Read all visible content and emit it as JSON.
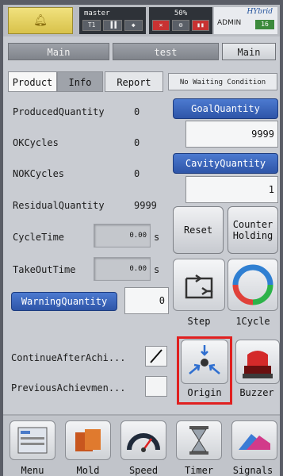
{
  "status": {
    "alarm_icon": "bell-icon",
    "branch": "master",
    "mode_cells": [
      "T1",
      "▐▐",
      "◆"
    ],
    "speed": "50%",
    "speed_cells": [
      "✕",
      "⚙",
      "▮▮"
    ],
    "brand": "HYbrid",
    "user": "ADMIN",
    "level": "16"
  },
  "tabs": [
    "Main",
    "test",
    "Main"
  ],
  "subtabs": [
    "Product",
    "Info",
    "Report"
  ],
  "wait_label": "No Waiting Condition",
  "rows": {
    "produced": {
      "label": "ProducedQuantity",
      "value": "0"
    },
    "ok": {
      "label": "OKCycles",
      "value": "0"
    },
    "nok": {
      "label": "NOKCycles",
      "value": "0"
    },
    "residual": {
      "label": "ResidualQuantity",
      "value": "9999"
    },
    "cycle": {
      "label": "CycleTime",
      "value": "0.00",
      "unit": "s"
    },
    "takeout": {
      "label": "TakeOutTime",
      "value": "0.00",
      "unit": "s"
    }
  },
  "warning": {
    "label": "WarningQuantity",
    "value": "0"
  },
  "goal": {
    "label": "GoalQuantity",
    "value": "9999"
  },
  "cavity": {
    "label": "CavityQuantity",
    "value": "1"
  },
  "buttons": {
    "reset": "Reset",
    "counter_line1": "Counter",
    "counter_line2": "Holding",
    "step": "Step",
    "cycle": "1Cycle",
    "origin": "Origin",
    "buzzer": "Buzzer"
  },
  "checks": {
    "continue": {
      "label": "ContinueAfterAchi...",
      "checked": true
    },
    "previous": {
      "label": "PreviousAchievmen...",
      "checked": false
    }
  },
  "dock": [
    "Menu",
    "Mold",
    "Speed",
    "Timer",
    "Signals"
  ]
}
